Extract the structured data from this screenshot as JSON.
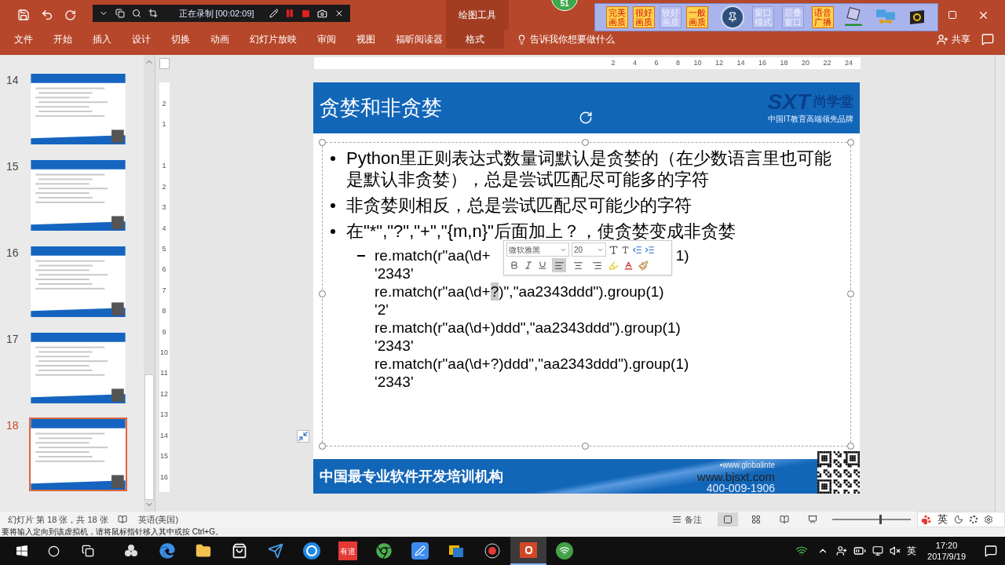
{
  "title_bar": {
    "contextual_label": "绘图工具"
  },
  "recorder_bar": {
    "status": "正在录制 [00:02:09]"
  },
  "notification_badge": {
    "count": "51"
  },
  "quality_toolbar": {
    "buttons": [
      {
        "label": "完美画质",
        "disabled": false
      },
      {
        "label": "很好画质",
        "disabled": false
      },
      {
        "label": "较好画质",
        "disabled": true
      },
      {
        "label": "一般画质",
        "disabled": false
      }
    ],
    "mode_buttons": [
      {
        "label": "窗口模式",
        "disabled": true
      },
      {
        "label": "层叠窗口",
        "disabled": true
      },
      {
        "label": "语音广播",
        "disabled": false
      }
    ]
  },
  "ribbon_tabs": [
    {
      "label": "文件",
      "selected": false
    },
    {
      "label": "开始",
      "selected": false
    },
    {
      "label": "插入",
      "selected": false
    },
    {
      "label": "设计",
      "selected": false
    },
    {
      "label": "切换",
      "selected": false
    },
    {
      "label": "动画",
      "selected": false
    },
    {
      "label": "幻灯片放映",
      "selected": false
    },
    {
      "label": "审阅",
      "selected": false
    },
    {
      "label": "视图",
      "selected": false
    },
    {
      "label": "福昕阅读器",
      "selected": false
    },
    {
      "label": "格式",
      "selected": true
    }
  ],
  "tell_me": {
    "placeholder": "告诉我你想要做什么"
  },
  "share": {
    "label": "共享"
  },
  "thumbnails": [
    {
      "number": "14",
      "selected": false
    },
    {
      "number": "15",
      "selected": false
    },
    {
      "number": "16",
      "selected": false
    },
    {
      "number": "17",
      "selected": false
    },
    {
      "number": "18",
      "selected": true
    }
  ],
  "rulers": {
    "horizontal": [
      "2",
      "4",
      "6",
      "8",
      "10",
      "12",
      "14",
      "16",
      "18",
      "20",
      "22",
      "24"
    ],
    "vertical": [
      "2",
      "1",
      "1",
      "2",
      "3",
      "4",
      "5",
      "6",
      "7",
      "8",
      "9",
      "10",
      "11",
      "12",
      "13",
      "14",
      "15",
      "16"
    ]
  },
  "slide": {
    "title": "贪婪和非贪婪",
    "logo": {
      "mark": "SXT",
      "name": "尚学堂",
      "tagline": "中国IT教育高端领先品牌"
    },
    "bullets": [
      "Python里正则表达式数量词默认是贪婪的（在少数语言里也可能是默认非贪婪），总是尝试匹配尽可能多的字符",
      "非贪婪则相反，总是尝试匹配尽可能少的字符",
      "在\"*\",\"?\",\"+\",\"{m,n}\"后面加上？，使贪婪变成非贪婪"
    ],
    "code_lines": [
      {
        "covered": true,
        "parts": [
          {
            "text": "re.match(r\"aa(\\d+",
            "selected": false
          },
          {
            "text": "1)",
            "selected": false
          }
        ]
      },
      {
        "parts": [
          {
            "text": "'2343'",
            "selected": false
          }
        ]
      },
      {
        "parts": [
          {
            "text": "re.match(r\"aa(\\d+",
            "selected": false
          },
          {
            "text": "?",
            "selected": true
          },
          {
            "text": ")\",\"aa2343ddd\").group(1)",
            "selected": false
          }
        ]
      },
      {
        "parts": [
          {
            "text": "'2'",
            "selected": false
          }
        ]
      },
      {
        "parts": [
          {
            "text": "re.match(r\"aa(\\d+)ddd\",\"aa2343ddd\").group(1)",
            "selected": false
          }
        ]
      },
      {
        "parts": [
          {
            "text": "'2343'",
            "selected": false
          }
        ]
      },
      {
        "parts": [
          {
            "text": "re.match(r\"aa(\\d+?)ddd\",\"aa2343ddd\").group(1)",
            "selected": false
          }
        ]
      },
      {
        "parts": [
          {
            "text": "'2343'",
            "selected": false
          }
        ]
      }
    ],
    "footer": {
      "slogan": "中国最专业软件开发培训机构",
      "site_overlay": "•www.globalinte",
      "website": "www.bjsxt.com",
      "phone": "400-009-1906"
    }
  },
  "mini_toolbar": {
    "font": "微软雅黑",
    "size": "20",
    "alignments": [
      {
        "kind": "left",
        "selected": true
      },
      {
        "kind": "center",
        "selected": false
      },
      {
        "kind": "right",
        "selected": false
      }
    ]
  },
  "status_bar": {
    "slide_info": "幻灯片 第 18 张，共 18 张",
    "language": "英语(美国)",
    "notes": "备注",
    "views": [
      {
        "kind": "normal",
        "selected": true
      },
      {
        "kind": "sorter",
        "selected": false
      },
      {
        "kind": "reading",
        "selected": false
      },
      {
        "kind": "slideshow",
        "selected": false
      }
    ],
    "zoom": {
      "level": 0.62
    }
  },
  "ime_bar": {
    "mode": "英"
  },
  "vm_hint": "要将输入定向到该虚拟机，请将鼠标指针移入其中或按 Ctrl+G。",
  "taskbar": {
    "apps": [
      {
        "kind": "fan",
        "active": false
      },
      {
        "kind": "edge",
        "active": false
      },
      {
        "kind": "folder",
        "active": false
      },
      {
        "kind": "store",
        "active": false
      },
      {
        "kind": "bird",
        "active": false
      },
      {
        "kind": "k",
        "active": false
      },
      {
        "kind": "youdao",
        "label": "有道",
        "active": false
      },
      {
        "kind": "chrome",
        "active": false
      },
      {
        "kind": "pen",
        "active": false
      },
      {
        "kind": "boxes",
        "active": false
      },
      {
        "kind": "record",
        "active": false
      },
      {
        "kind": "powerpoint",
        "active": true
      },
      {
        "kind": "wifi-app",
        "active": false
      }
    ],
    "ime": "英",
    "time": "17:20",
    "date": "2017/9/19"
  }
}
